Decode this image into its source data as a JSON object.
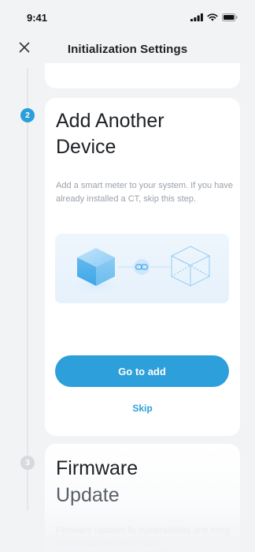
{
  "status_bar": {
    "time": "9:41"
  },
  "header": {
    "title": "Initialization Settings",
    "close_icon": "close-icon"
  },
  "steps": [
    {
      "number": "2",
      "title_line1": "Add Another",
      "title_line2": "Device",
      "description": "Add a smart meter to your system. If you have already installed a CT, skip this step.",
      "primary_button": "Go to add",
      "secondary_link": "Skip"
    },
    {
      "number": "3",
      "title_line1": "Firmware",
      "title_line2": "Update",
      "description": "Firmware updates fix vulnerabilities and bring new enhancements to your"
    }
  ],
  "colors": {
    "accent": "#2d9fda",
    "background": "#f2f3f5",
    "card": "#ffffff",
    "muted_text": "#9aa1aa",
    "inactive_badge": "#d6d9de"
  },
  "icons": {
    "status": [
      "signal-icon",
      "wifi-icon",
      "battery-icon"
    ],
    "illustration": [
      "solid-cube-icon",
      "link-icon",
      "wireframe-cube-icon"
    ]
  }
}
